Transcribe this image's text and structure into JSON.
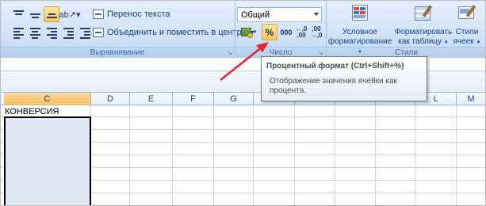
{
  "ribbon": {
    "alignment": {
      "label": "Выравнивание",
      "wrap_text_label": "Перенос текста",
      "merge_center_label": "Объединить и поместить в центре"
    },
    "number": {
      "label": "Число",
      "format_value": "Общий",
      "percent_symbol": "%",
      "thousands_symbol": "000",
      "increase_decimal_symbol": "←,0\n,00",
      "decrease_decimal_symbol": ",00\n→,0"
    },
    "styles": {
      "label": "Стили",
      "conditional_formatting_line1": "Условное",
      "conditional_formatting_line2": "форматирование",
      "format_as_table_line1": "Форматировать",
      "format_as_table_line2": "как таблицу",
      "cell_styles_line1": "Стили",
      "cell_styles_line2": "ячеек"
    }
  },
  "tooltip": {
    "title": "Процентный формат (Ctrl+Shift+%)",
    "description_line1": "Отображение значения ячейки как",
    "description_line2": "процента."
  },
  "sheet": {
    "columns": [
      "C",
      "D",
      "E",
      "F",
      "G",
      "H",
      "I",
      "J",
      "K",
      "L",
      "M"
    ],
    "selected_column": "C",
    "cell_c1": "КОНВЕРСИЯ"
  },
  "colors": {
    "arrow": "#e8232a",
    "selection_fill": "#dfe6f5",
    "active_button": "#f8c75a"
  }
}
